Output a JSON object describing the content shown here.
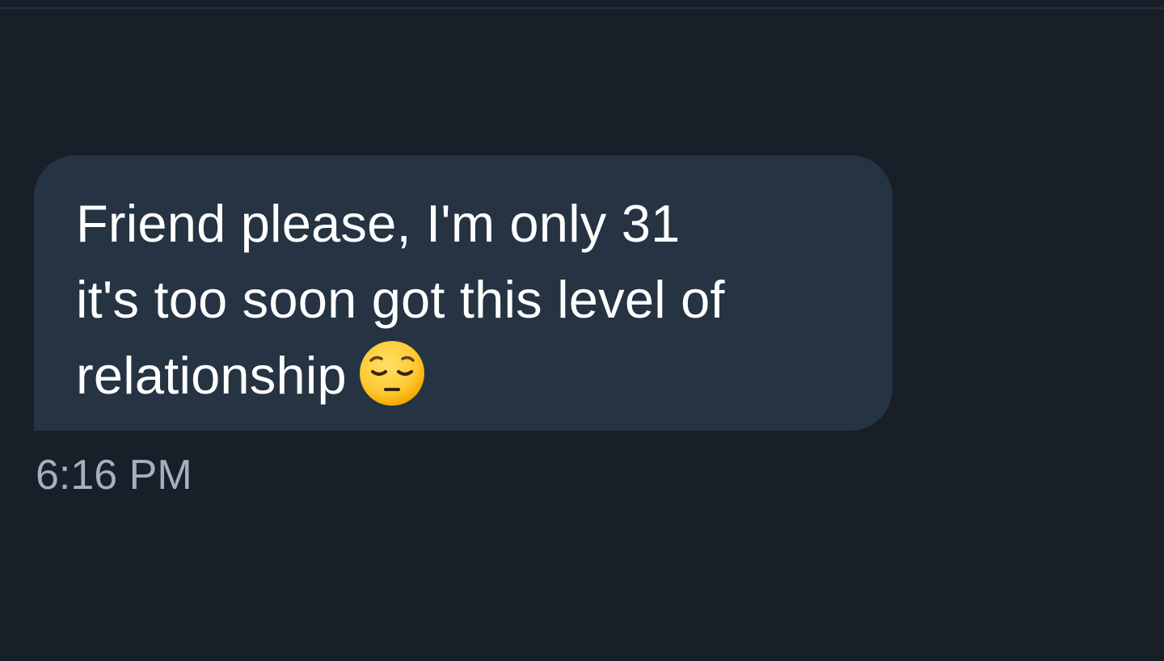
{
  "message": {
    "lines": [
      "Friend please, I'm only 31",
      "it's too soon got this level of",
      "relationship"
    ],
    "emoji": "pensive-face-emoji",
    "timestamp": "6:16 PM"
  },
  "colors": {
    "background": "#181f28",
    "bubble": "#253343",
    "text": "#ffffff",
    "timestamp": "#a4b0be",
    "emoji_face": "#ffcc33"
  }
}
